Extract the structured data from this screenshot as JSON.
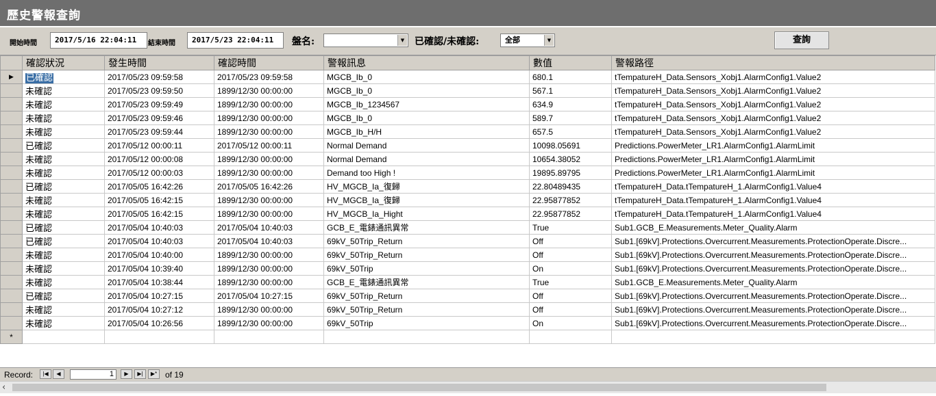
{
  "window": {
    "title": "歷史警報查詢"
  },
  "filters": {
    "start_label": "開始時間",
    "start_value": "2017/5/16 22:04:11",
    "end_label": "結束時間",
    "end_value": "2017/5/23 22:04:11",
    "panel_label": "盤名:",
    "panel_value": "",
    "ack_label": "已確認/未確認:",
    "ack_value": "全部",
    "query_button": "查詢"
  },
  "grid": {
    "columns": [
      "確認狀況",
      "發生時間",
      "確認時間",
      "警報訊息",
      "數值",
      "警報路徑"
    ],
    "current_row_marker": "▶",
    "new_row_marker": "*",
    "rows": [
      [
        "已確認",
        "2017/05/23 09:59:58",
        "2017/05/23 09:59:58",
        "MGCB_Ib_0",
        "680.1",
        "tTempatureH_Data.Sensors_Xobj1.AlarmConfig1.Value2"
      ],
      [
        "未確認",
        "2017/05/23 09:59:50",
        "1899/12/30 00:00:00",
        "MGCB_Ib_0",
        "567.1",
        "tTempatureH_Data.Sensors_Xobj1.AlarmConfig1.Value2"
      ],
      [
        "未確認",
        "2017/05/23 09:59:49",
        "1899/12/30 00:00:00",
        "MGCB_Ib_1234567",
        "634.9",
        "tTempatureH_Data.Sensors_Xobj1.AlarmConfig1.Value2"
      ],
      [
        "未確認",
        "2017/05/23 09:59:46",
        "1899/12/30 00:00:00",
        "MGCB_Ib_0",
        "589.7",
        "tTempatureH_Data.Sensors_Xobj1.AlarmConfig1.Value2"
      ],
      [
        "未確認",
        "2017/05/23 09:59:44",
        "1899/12/30 00:00:00",
        "MGCB_Ib_H/H",
        "657.5",
        "tTempatureH_Data.Sensors_Xobj1.AlarmConfig1.Value2"
      ],
      [
        "已確認",
        "2017/05/12 00:00:11",
        "2017/05/12 00:00:11",
        "Normal Demand",
        "10098.05691",
        "Predictions.PowerMeter_LR1.AlarmConfig1.AlarmLimit"
      ],
      [
        "未確認",
        "2017/05/12 00:00:08",
        "1899/12/30 00:00:00",
        "Normal Demand",
        "10654.38052",
        "Predictions.PowerMeter_LR1.AlarmConfig1.AlarmLimit"
      ],
      [
        "未確認",
        "2017/05/12 00:00:03",
        "1899/12/30 00:00:00",
        "Demand too High !",
        "19895.89795",
        "Predictions.PowerMeter_LR1.AlarmConfig1.AlarmLimit"
      ],
      [
        "已確認",
        "2017/05/05 16:42:26",
        "2017/05/05 16:42:26",
        "HV_MGCB_Ia_復歸",
        "22.80489435",
        "tTempatureH_Data.tTempatureH_1.AlarmConfig1.Value4"
      ],
      [
        "未確認",
        "2017/05/05 16:42:15",
        "1899/12/30 00:00:00",
        "HV_MGCB_Ia_復歸",
        "22.95877852",
        "tTempatureH_Data.tTempatureH_1.AlarmConfig1.Value4"
      ],
      [
        "未確認",
        "2017/05/05 16:42:15",
        "1899/12/30 00:00:00",
        "HV_MGCB_Ia_Hight",
        "22.95877852",
        "tTempatureH_Data.tTempatureH_1.AlarmConfig1.Value4"
      ],
      [
        "已確認",
        "2017/05/04 10:40:03",
        "2017/05/04 10:40:03",
        "GCB_E_電錶通訊異常",
        "True",
        "Sub1.GCB_E.Measurements.Meter_Quality.Alarm"
      ],
      [
        "已確認",
        "2017/05/04 10:40:03",
        "2017/05/04 10:40:03",
        "69kV_50Trip_Return",
        "Off",
        "Sub1.[69kV].Protections.Overcurrent.Measurements.ProtectionOperate.Discre..."
      ],
      [
        "未確認",
        "2017/05/04 10:40:00",
        "1899/12/30 00:00:00",
        "69kV_50Trip_Return",
        "Off",
        "Sub1.[69kV].Protections.Overcurrent.Measurements.ProtectionOperate.Discre..."
      ],
      [
        "未確認",
        "2017/05/04 10:39:40",
        "1899/12/30 00:00:00",
        "69kV_50Trip",
        "On",
        "Sub1.[69kV].Protections.Overcurrent.Measurements.ProtectionOperate.Discre..."
      ],
      [
        "未確認",
        "2017/05/04 10:38:44",
        "1899/12/30 00:00:00",
        "GCB_E_電錶通訊異常",
        "True",
        "Sub1.GCB_E.Measurements.Meter_Quality.Alarm"
      ],
      [
        "已確認",
        "2017/05/04 10:27:15",
        "2017/05/04 10:27:15",
        "69kV_50Trip_Return",
        "Off",
        "Sub1.[69kV].Protections.Overcurrent.Measurements.ProtectionOperate.Discre..."
      ],
      [
        "未確認",
        "2017/05/04 10:27:12",
        "1899/12/30 00:00:00",
        "69kV_50Trip_Return",
        "Off",
        "Sub1.[69kV].Protections.Overcurrent.Measurements.ProtectionOperate.Discre..."
      ],
      [
        "未確認",
        "2017/05/04 10:26:56",
        "1899/12/30 00:00:00",
        "69kV_50Trip",
        "On",
        "Sub1.[69kV].Protections.Overcurrent.Measurements.ProtectionOperate.Discre..."
      ]
    ]
  },
  "navigator": {
    "record_label": "Record:",
    "current_record": "1",
    "total_text": "of 19"
  },
  "icons": {
    "first": "first-record-icon",
    "prev": "prev-record-icon",
    "next": "next-record-icon",
    "last": "last-record-icon",
    "new": "new-record-icon",
    "scroll_left": "scroll-left-icon"
  },
  "colors": {
    "title_bar": "#6e6e6e",
    "toolbar": "#d4d0c8",
    "selection": "#3a6ea5"
  }
}
